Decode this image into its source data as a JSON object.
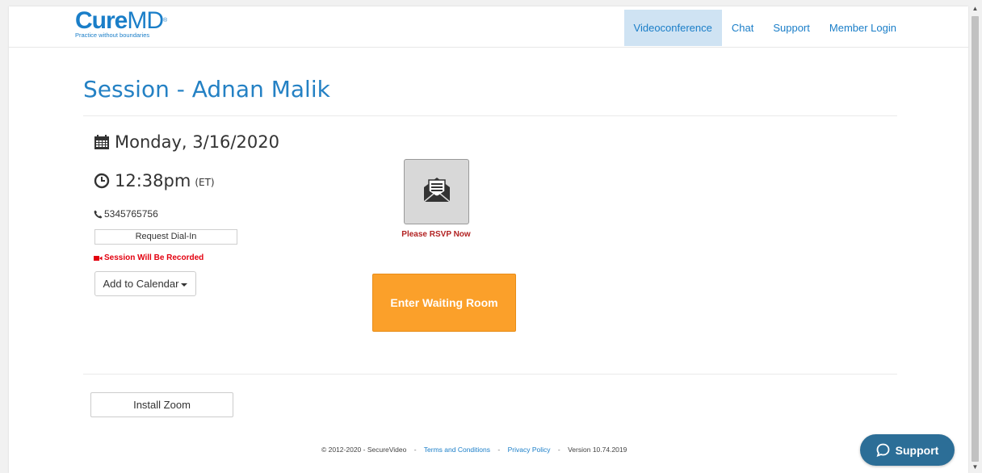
{
  "header": {
    "logo_bold": "Cure",
    "logo_light": "MD",
    "logo_tm": "®",
    "logo_tagline": "Practice without boundaries",
    "nav": [
      {
        "label": "Videoconference",
        "active": true
      },
      {
        "label": "Chat",
        "active": false
      },
      {
        "label": "Support",
        "active": false
      },
      {
        "label": "Member Login",
        "active": false
      }
    ]
  },
  "session": {
    "title": "Session - Adnan Malik",
    "date": "Monday, 3/16/2020",
    "time": "12:38pm",
    "timezone": "(ET)",
    "phone": "5345765756",
    "request_dialin_label": "Request Dial-In",
    "recorded_label": "Session Will Be Recorded",
    "add_to_calendar_label": "Add to Calendar",
    "rsvp_label": "Please RSVP Now",
    "enter_waiting_room_label": "Enter Waiting Room"
  },
  "install_zoom_label": "Install Zoom",
  "footer": {
    "copyright": "© 2012-2020 - SecureVideo",
    "sep": "-",
    "terms_label": "Terms and Conditions",
    "privacy_label": "Privacy Policy",
    "version": "Version 10.74.2019"
  },
  "support_button_label": "Support",
  "icons": {
    "calendar": "calendar-icon",
    "clock": "clock-icon",
    "phone": "phone-icon",
    "video": "video-camera-icon",
    "envelope": "envelope-open-icon",
    "chat": "chat-bubble-icon"
  },
  "colors": {
    "brand_blue": "#2481c4",
    "nav_active_bg": "#cfe3f3",
    "waiting_room_orange": "#fba02a",
    "recorded_red": "#e3000f",
    "support_button": "#2c6e97"
  }
}
